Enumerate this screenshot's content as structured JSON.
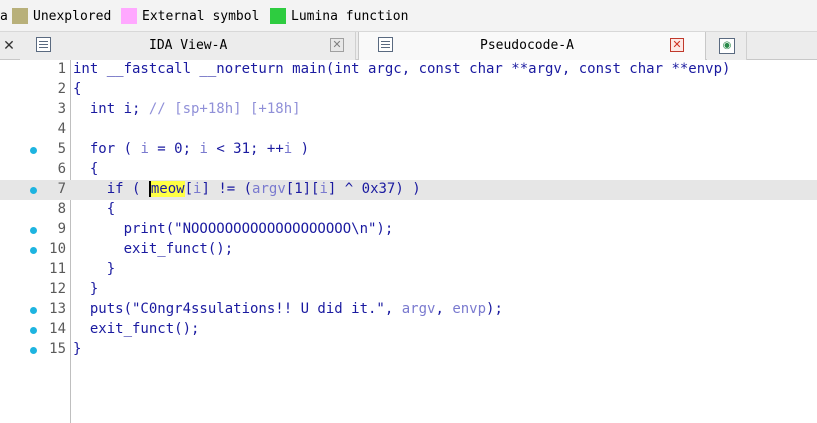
{
  "legend": {
    "partial_label": "a",
    "items": [
      {
        "label": "Unexplored",
        "color": "#b8b07a"
      },
      {
        "label": "External symbol",
        "color": "#ffa8ff"
      },
      {
        "label": "Lumina function",
        "color": "#2ecc40"
      }
    ]
  },
  "tabs": [
    {
      "title": "IDA View-A",
      "active": false
    },
    {
      "title": "Pseudocode-A",
      "active": true
    }
  ],
  "code": {
    "lines": [
      {
        "num": "1",
        "bp": false
      },
      {
        "num": "2",
        "bp": false
      },
      {
        "num": "3",
        "bp": false
      },
      {
        "num": "4",
        "bp": false
      },
      {
        "num": "5",
        "bp": true
      },
      {
        "num": "6",
        "bp": false
      },
      {
        "num": "7",
        "bp": true
      },
      {
        "num": "8",
        "bp": false
      },
      {
        "num": "9",
        "bp": true
      },
      {
        "num": "10",
        "bp": true
      },
      {
        "num": "11",
        "bp": false
      },
      {
        "num": "12",
        "bp": false
      },
      {
        "num": "13",
        "bp": true
      },
      {
        "num": "14",
        "bp": true
      },
      {
        "num": "15",
        "bp": true
      }
    ],
    "l1": "int __fastcall __noreturn main(int argc, const char **argv, const char **envp)",
    "l2": "{",
    "l3_a": "  int i; ",
    "l3_cmt": "// [sp+18h] [+18h]",
    "l5_a": "  for ( ",
    "l5_i1": "i",
    "l5_b": " = 0; ",
    "l5_i2": "i",
    "l5_c": " < 31; ++",
    "l5_i3": "i",
    "l5_d": " )",
    "l6": "  {",
    "l7_a": "    if ( ",
    "l7_meow_first": "m",
    "l7_meow_rest": "eow",
    "l7_b": "[",
    "l7_i1": "i",
    "l7_c": "] != (",
    "l7_argv": "argv",
    "l7_d": "[1][",
    "l7_i2": "i",
    "l7_e": "] ^ 0x37) )",
    "l8": "    {",
    "l9": "      print(\"NOOOOOOOOOOOOOOOOOOO\\n\");",
    "l10": "      exit_funct();",
    "l11": "    }",
    "l12": "  }",
    "l13_a": "  puts(\"C0ngr4ssulations!! U did it.\", ",
    "l13_argv": "argv",
    "l13_b": ", ",
    "l13_envp": "envp",
    "l13_c": ");",
    "l14": "  exit_funct();",
    "l15": "}"
  }
}
